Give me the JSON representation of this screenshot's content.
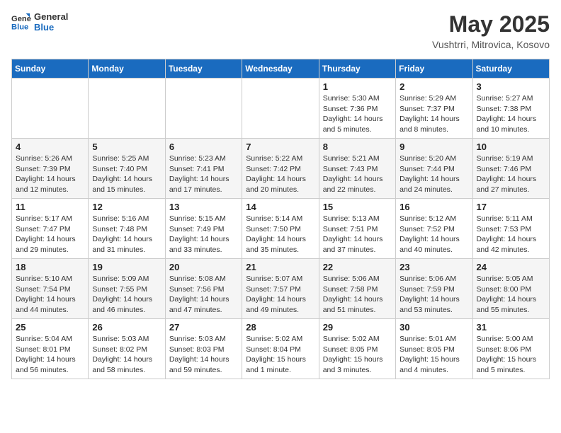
{
  "header": {
    "logo_general": "General",
    "logo_blue": "Blue",
    "month": "May 2025",
    "location": "Vushtrri, Mitrovica, Kosovo"
  },
  "weekdays": [
    "Sunday",
    "Monday",
    "Tuesday",
    "Wednesday",
    "Thursday",
    "Friday",
    "Saturday"
  ],
  "weeks": [
    [
      null,
      null,
      null,
      null,
      {
        "day": "1",
        "sunrise": "5:30 AM",
        "sunset": "7:36 PM",
        "daylight": "14 hours and 5 minutes."
      },
      {
        "day": "2",
        "sunrise": "5:29 AM",
        "sunset": "7:37 PM",
        "daylight": "14 hours and 8 minutes."
      },
      {
        "day": "3",
        "sunrise": "5:27 AM",
        "sunset": "7:38 PM",
        "daylight": "14 hours and 10 minutes."
      }
    ],
    [
      {
        "day": "4",
        "sunrise": "5:26 AM",
        "sunset": "7:39 PM",
        "daylight": "14 hours and 12 minutes."
      },
      {
        "day": "5",
        "sunrise": "5:25 AM",
        "sunset": "7:40 PM",
        "daylight": "14 hours and 15 minutes."
      },
      {
        "day": "6",
        "sunrise": "5:23 AM",
        "sunset": "7:41 PM",
        "daylight": "14 hours and 17 minutes."
      },
      {
        "day": "7",
        "sunrise": "5:22 AM",
        "sunset": "7:42 PM",
        "daylight": "14 hours and 20 minutes."
      },
      {
        "day": "8",
        "sunrise": "5:21 AM",
        "sunset": "7:43 PM",
        "daylight": "14 hours and 22 minutes."
      },
      {
        "day": "9",
        "sunrise": "5:20 AM",
        "sunset": "7:44 PM",
        "daylight": "14 hours and 24 minutes."
      },
      {
        "day": "10",
        "sunrise": "5:19 AM",
        "sunset": "7:46 PM",
        "daylight": "14 hours and 27 minutes."
      }
    ],
    [
      {
        "day": "11",
        "sunrise": "5:17 AM",
        "sunset": "7:47 PM",
        "daylight": "14 hours and 29 minutes."
      },
      {
        "day": "12",
        "sunrise": "5:16 AM",
        "sunset": "7:48 PM",
        "daylight": "14 hours and 31 minutes."
      },
      {
        "day": "13",
        "sunrise": "5:15 AM",
        "sunset": "7:49 PM",
        "daylight": "14 hours and 33 minutes."
      },
      {
        "day": "14",
        "sunrise": "5:14 AM",
        "sunset": "7:50 PM",
        "daylight": "14 hours and 35 minutes."
      },
      {
        "day": "15",
        "sunrise": "5:13 AM",
        "sunset": "7:51 PM",
        "daylight": "14 hours and 37 minutes."
      },
      {
        "day": "16",
        "sunrise": "5:12 AM",
        "sunset": "7:52 PM",
        "daylight": "14 hours and 40 minutes."
      },
      {
        "day": "17",
        "sunrise": "5:11 AM",
        "sunset": "7:53 PM",
        "daylight": "14 hours and 42 minutes."
      }
    ],
    [
      {
        "day": "18",
        "sunrise": "5:10 AM",
        "sunset": "7:54 PM",
        "daylight": "14 hours and 44 minutes."
      },
      {
        "day": "19",
        "sunrise": "5:09 AM",
        "sunset": "7:55 PM",
        "daylight": "14 hours and 46 minutes."
      },
      {
        "day": "20",
        "sunrise": "5:08 AM",
        "sunset": "7:56 PM",
        "daylight": "14 hours and 47 minutes."
      },
      {
        "day": "21",
        "sunrise": "5:07 AM",
        "sunset": "7:57 PM",
        "daylight": "14 hours and 49 minutes."
      },
      {
        "day": "22",
        "sunrise": "5:06 AM",
        "sunset": "7:58 PM",
        "daylight": "14 hours and 51 minutes."
      },
      {
        "day": "23",
        "sunrise": "5:06 AM",
        "sunset": "7:59 PM",
        "daylight": "14 hours and 53 minutes."
      },
      {
        "day": "24",
        "sunrise": "5:05 AM",
        "sunset": "8:00 PM",
        "daylight": "14 hours and 55 minutes."
      }
    ],
    [
      {
        "day": "25",
        "sunrise": "5:04 AM",
        "sunset": "8:01 PM",
        "daylight": "14 hours and 56 minutes."
      },
      {
        "day": "26",
        "sunrise": "5:03 AM",
        "sunset": "8:02 PM",
        "daylight": "14 hours and 58 minutes."
      },
      {
        "day": "27",
        "sunrise": "5:03 AM",
        "sunset": "8:03 PM",
        "daylight": "14 hours and 59 minutes."
      },
      {
        "day": "28",
        "sunrise": "5:02 AM",
        "sunset": "8:04 PM",
        "daylight": "15 hours and 1 minute."
      },
      {
        "day": "29",
        "sunrise": "5:02 AM",
        "sunset": "8:05 PM",
        "daylight": "15 hours and 3 minutes."
      },
      {
        "day": "30",
        "sunrise": "5:01 AM",
        "sunset": "8:05 PM",
        "daylight": "15 hours and 4 minutes."
      },
      {
        "day": "31",
        "sunrise": "5:00 AM",
        "sunset": "8:06 PM",
        "daylight": "15 hours and 5 minutes."
      }
    ]
  ],
  "labels": {
    "sunrise_prefix": "Sunrise: ",
    "sunset_prefix": "Sunset: ",
    "daylight_prefix": "Daylight: "
  }
}
